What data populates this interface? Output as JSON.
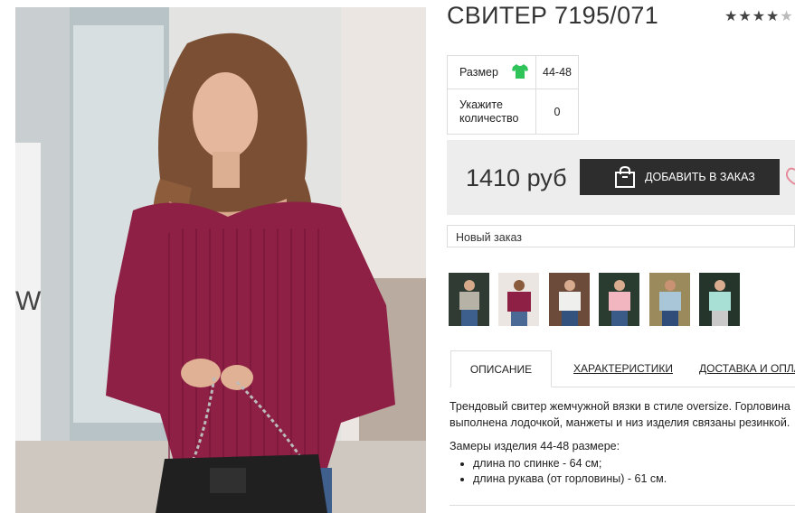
{
  "product": {
    "title": "СВИТЕР 7195/071",
    "rating_stars_filled": 4,
    "rating_stars_total": 5
  },
  "options": {
    "size_label": "Размер",
    "size_value": "44-48",
    "qty_label": "Укажите количество",
    "qty_value": "0"
  },
  "purchase": {
    "price": "1410 руб",
    "add_button_label": "ДОБАВИТЬ В ЗАКАЗ"
  },
  "order_select": {
    "selected": "Новый заказ"
  },
  "thumbnails": [
    {
      "name": "thumb-grey"
    },
    {
      "name": "thumb-burgundy"
    },
    {
      "name": "thumb-white"
    },
    {
      "name": "thumb-pink"
    },
    {
      "name": "thumb-blue"
    },
    {
      "name": "thumb-mint"
    }
  ],
  "tabs": {
    "description": "ОПИСАНИЕ",
    "characteristics": "ХАРАКТЕРИСТИКИ",
    "delivery": "ДОСТАВКА И ОПЛАТА"
  },
  "description": {
    "text": "Трендовый свитер жемчужной вязки в стиле oversize. Горловина выполнена лодочкой, манжеты и низ изделия связаны резинкой.",
    "measurements_title": "Замеры изделия 44-48 размере:",
    "measurements": [
      "длина по спинке - 64 см;",
      "длина рукава (от горловины) - 61 см."
    ]
  },
  "colors": {
    "sweater": "#8e1f45",
    "button": "#2d2d2d",
    "price_bar": "#ededed",
    "size_icon": "#2fc45a"
  }
}
